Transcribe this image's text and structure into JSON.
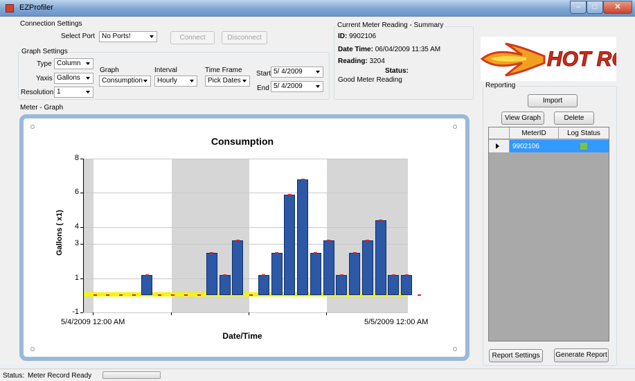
{
  "window": {
    "title": "EZProfiler"
  },
  "connection": {
    "title": "Connection Settings",
    "port_label": "Select Port",
    "port_value": "No Ports!",
    "connect_label": "Connect",
    "disconnect_label": "Disconnect"
  },
  "graph_settings": {
    "title": "Graph Settings",
    "type_label": "Type",
    "type_value": "Column",
    "yaxis_label": "Yaxis",
    "yaxis_value": "Gallons",
    "resolution_label": "Resolution",
    "resolution_value": "1",
    "graph_label": "Graph",
    "graph_value": "Consumption",
    "interval_label": "Interval",
    "interval_value": "Hourly",
    "timeframe_label": "Time Frame",
    "timeframe_value": "Pick Dates",
    "start_label": "Start",
    "start_value": "5/ 4/2009",
    "end_label": "End",
    "end_value": "5/ 4/2009"
  },
  "summary": {
    "title": "Current Meter Reading - Summary",
    "id_label": "ID:",
    "id_value": "9902106",
    "datetime_label": "Date Time:",
    "datetime_value": "06/04/2009 11:35 AM",
    "reading_label": "Reading:",
    "reading_value": "3204",
    "status_label": "Status:",
    "status_value": "Good Meter Reading"
  },
  "logo": {
    "text": "HOT ROD"
  },
  "meter_graph": {
    "title": "Meter - Graph"
  },
  "chart_data": {
    "type": "bar",
    "title": "Consumption",
    "xlabel": "Date/Time",
    "ylabel": "Gallons ( x1)",
    "y_tick_labels": [
      "-1",
      "1",
      "3",
      "4",
      "6",
      "8"
    ],
    "x_tick_labels": [
      "5/4/2009 12:00 AM",
      "5/5/2009 12:00 AM"
    ],
    "values": [
      0,
      0,
      0,
      0,
      1.2,
      0,
      0,
      0,
      0,
      2.5,
      1.2,
      3.2,
      0,
      1.2,
      2.5,
      5.9,
      6.8,
      2.5,
      3.2,
      1.2,
      2.5,
      3.2,
      4.4,
      1.2,
      1.2,
      0
    ],
    "band_pattern": [
      "gray",
      "white",
      "gray",
      "white",
      "gray"
    ]
  },
  "reporting": {
    "title": "Reporting",
    "import_label": "Import",
    "view_graph_label": "View Graph",
    "delete_label": "Delete",
    "columns": [
      "MeterID",
      "Log Status"
    ],
    "rows": [
      {
        "meter_id": "9902106",
        "status_color": "#7cc142"
      }
    ],
    "report_settings_label": "Report Settings",
    "generate_report_label": "Generate Report"
  },
  "status": {
    "label": "Status:",
    "value": "Meter Record Ready"
  },
  "colors": {
    "bar": "#2d58a6",
    "baseline": "#f5f500",
    "marker": "#e02020"
  }
}
